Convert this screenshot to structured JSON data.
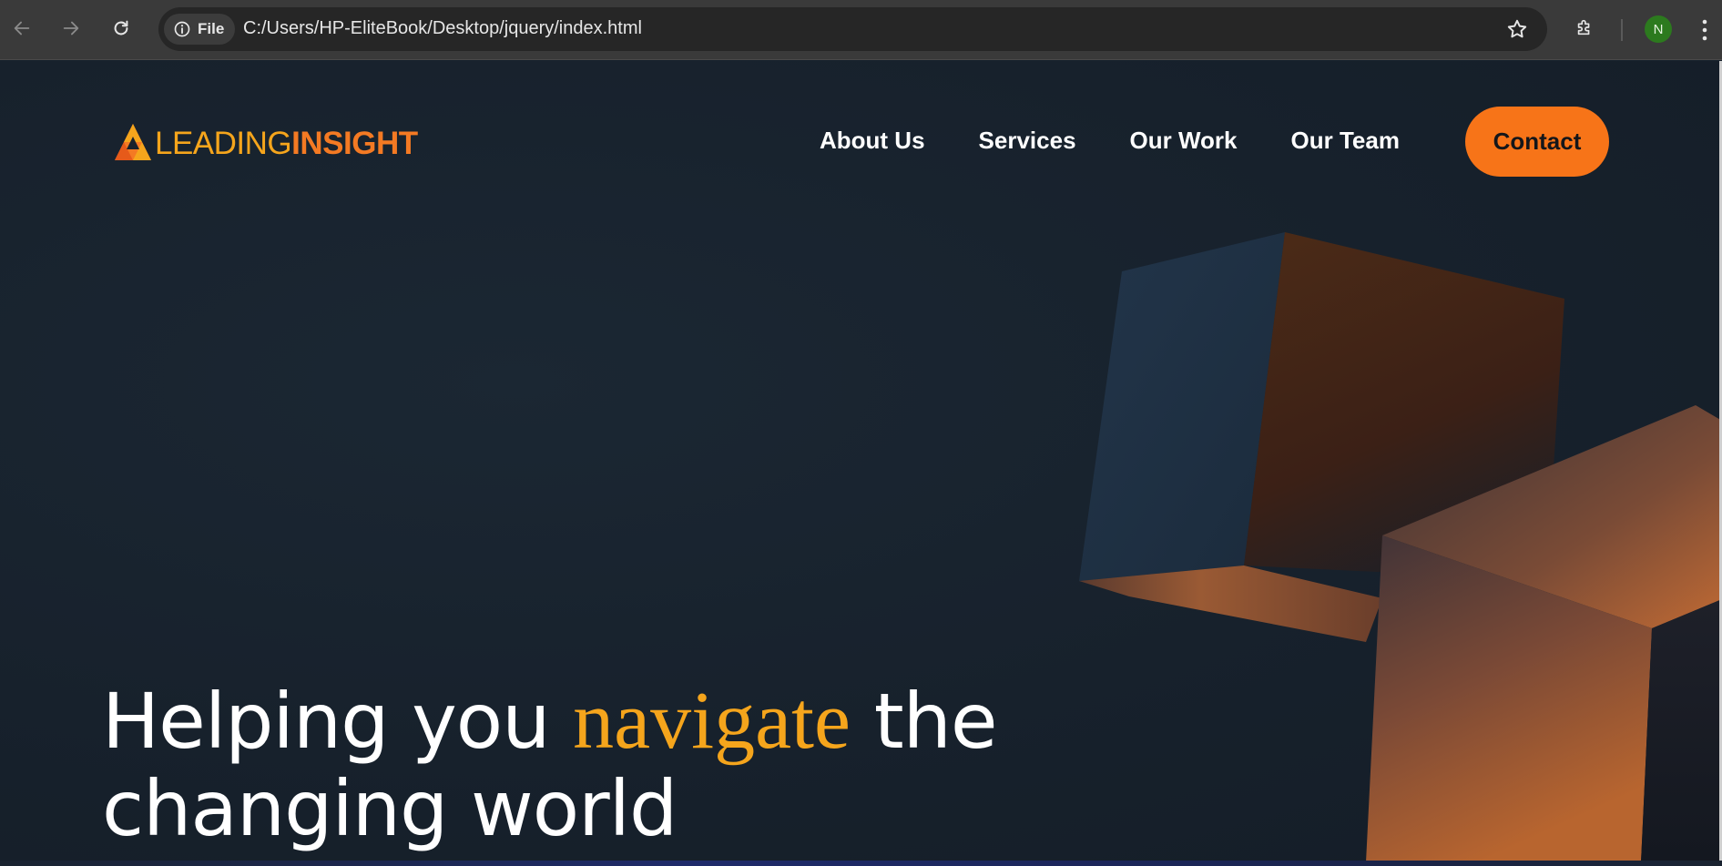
{
  "browser": {
    "site_chip_label": "File",
    "url": "C:/Users/HP-EliteBook/Desktop/jquery/index.html",
    "avatar_initial": "N",
    "icons": [
      "back-icon",
      "forward-icon",
      "reload-icon",
      "info-icon",
      "star-icon",
      "extensions-icon",
      "menu-icon"
    ]
  },
  "site": {
    "logo": {
      "part1": "LEADING",
      "part2": "INSIGHT",
      "color_part1": "#f5a51c",
      "color_part2": "#f47a23"
    },
    "nav": {
      "items": [
        {
          "label": "About Us"
        },
        {
          "label": "Services"
        },
        {
          "label": "Our Work"
        },
        {
          "label": "Our Team"
        }
      ],
      "contact_label": "Contact",
      "contact_color": "#f77418"
    },
    "hero": {
      "line1_before": "Helping you ",
      "line1_accent": "navigate",
      "line1_after": " the",
      "line2": "changing world",
      "accent_color": "#f5a51c"
    },
    "background_color": "#17212c"
  }
}
